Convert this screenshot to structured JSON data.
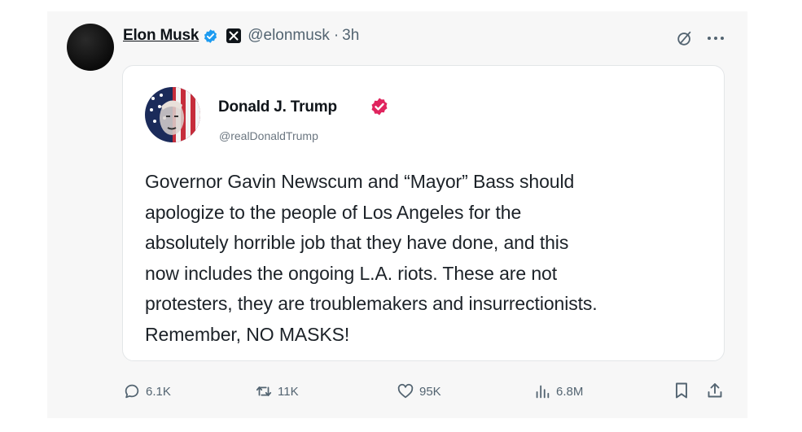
{
  "post": {
    "author_name": "Elon Musk",
    "author_handle": "@elonmusk",
    "separator": "·",
    "time": "3h",
    "icons": {
      "verified": "verified-badge-icon",
      "platform": "x-logo-icon",
      "grok": "grok-icon",
      "more": "more-icon"
    }
  },
  "quote": {
    "author_name": "Donald J. Trump",
    "author_handle": "@realDonaldTrump",
    "badge": "verified-badge-pink-icon",
    "text": "Governor Gavin Newscum and “Mayor” Bass should\napologize to the people of Los Angeles for the\nabsolutely horrible job that they have done, and this\nnow includes the ongoing L.A. riots. These are not\nprotesters, they are troublemakers and insurrectionists.\nRemember, NO MASKS!"
  },
  "actions": {
    "replies": "6.1K",
    "reposts": "11K",
    "likes": "95K",
    "views": "6.8M",
    "icons": [
      "reply-icon",
      "repost-icon",
      "like-icon",
      "views-icon",
      "bookmark-icon",
      "share-icon"
    ]
  },
  "colors": {
    "verified_blue": "#1d9bf0",
    "verified_pink": "#e0245e",
    "muted": "#536471",
    "card_bg": "#f7f7f7"
  }
}
